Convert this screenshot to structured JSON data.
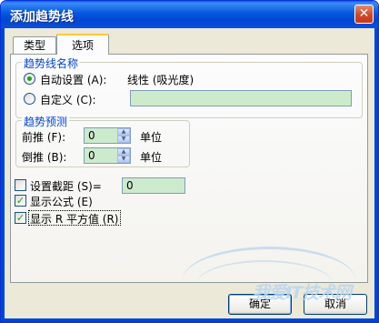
{
  "window": {
    "title": "添加趋势线",
    "close_glyph": "✕"
  },
  "tabs": [
    {
      "label": "类型",
      "active": false
    },
    {
      "label": "选项",
      "active": true
    }
  ],
  "trendline_name": {
    "legend": "趋势线名称",
    "auto": {
      "label": "自动设置 (A):",
      "selected": true,
      "value": "线性 (吸光度)"
    },
    "custom": {
      "label": "自定义 (C):",
      "selected": false,
      "value": ""
    }
  },
  "forecast": {
    "legend": "趋势预测",
    "forward": {
      "label": "前推 (F):",
      "value": "0",
      "unit": "单位"
    },
    "backward": {
      "label": "倒推 (B):",
      "value": "0",
      "unit": "单位"
    }
  },
  "options": {
    "intercept": {
      "label": "设置截距 (S)=",
      "checked": false,
      "value": "0"
    },
    "show_equation": {
      "label": "显示公式 (E)",
      "checked": true
    },
    "show_r2": {
      "label": "显示 R 平方值 (R)",
      "checked": true
    }
  },
  "buttons": {
    "ok": "确定",
    "cancel": "取消"
  },
  "watermark": {
    "text": "我爱IT技术网"
  },
  "colors": {
    "title_bar": "#0046d4",
    "legend": "#0046d5",
    "check": "#21a121",
    "field_bg": "#ccebcc"
  }
}
